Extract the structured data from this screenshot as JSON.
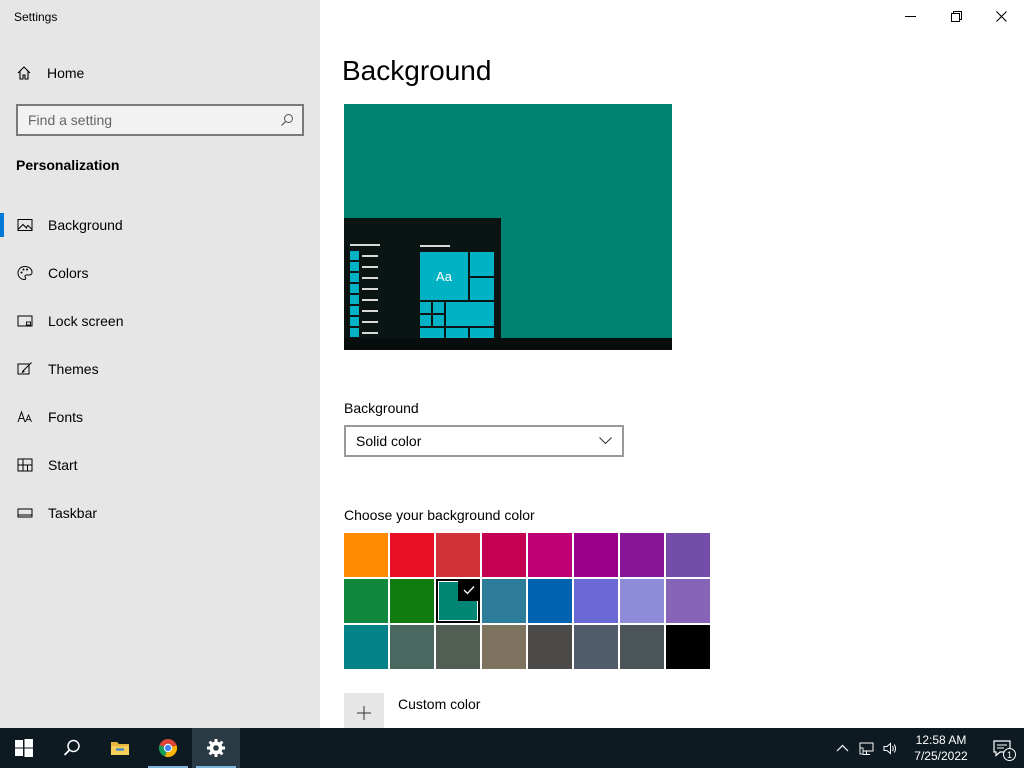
{
  "window": {
    "title": "Settings"
  },
  "sidebar": {
    "home_label": "Home",
    "search_placeholder": "Find a setting",
    "section_title": "Personalization",
    "items": [
      {
        "label": "Background",
        "icon": "picture-icon",
        "active": true
      },
      {
        "label": "Colors",
        "icon": "palette-icon"
      },
      {
        "label": "Lock screen",
        "icon": "lock-screen-icon"
      },
      {
        "label": "Themes",
        "icon": "themes-icon"
      },
      {
        "label": "Fonts",
        "icon": "fonts-icon"
      },
      {
        "label": "Start",
        "icon": "start-icon"
      },
      {
        "label": "Taskbar",
        "icon": "taskbar-icon"
      }
    ]
  },
  "main": {
    "title": "Background",
    "preview": {
      "tile_label": "Aa",
      "background_color": "#008272",
      "accent_color": "#00b2c4"
    },
    "background_label": "Background",
    "background_value": "Solid color",
    "choose_color_label": "Choose your background color",
    "swatches": [
      "#ff8c00",
      "#e81123",
      "#d13438",
      "#c30052",
      "#bf0077",
      "#9a0089",
      "#881798",
      "#744da9",
      "#10893e",
      "#107c10",
      "#018574",
      "#2d7d9a",
      "#0063b1",
      "#6b69d6",
      "#8e8cd8",
      "#8764b8",
      "#038387",
      "#486860",
      "#525e54",
      "#7e735f",
      "#4c4a48",
      "#515c6b",
      "#4a5459",
      "#000000"
    ],
    "selected_swatch_index": 10,
    "custom_color_label": "Custom color"
  },
  "taskbar": {
    "time": "12:58 AM",
    "date": "7/25/2022",
    "notification_count": "1",
    "apps": [
      "start-icon",
      "search-icon",
      "file-explorer-icon",
      "chrome-icon",
      "settings-gear-icon"
    ]
  }
}
